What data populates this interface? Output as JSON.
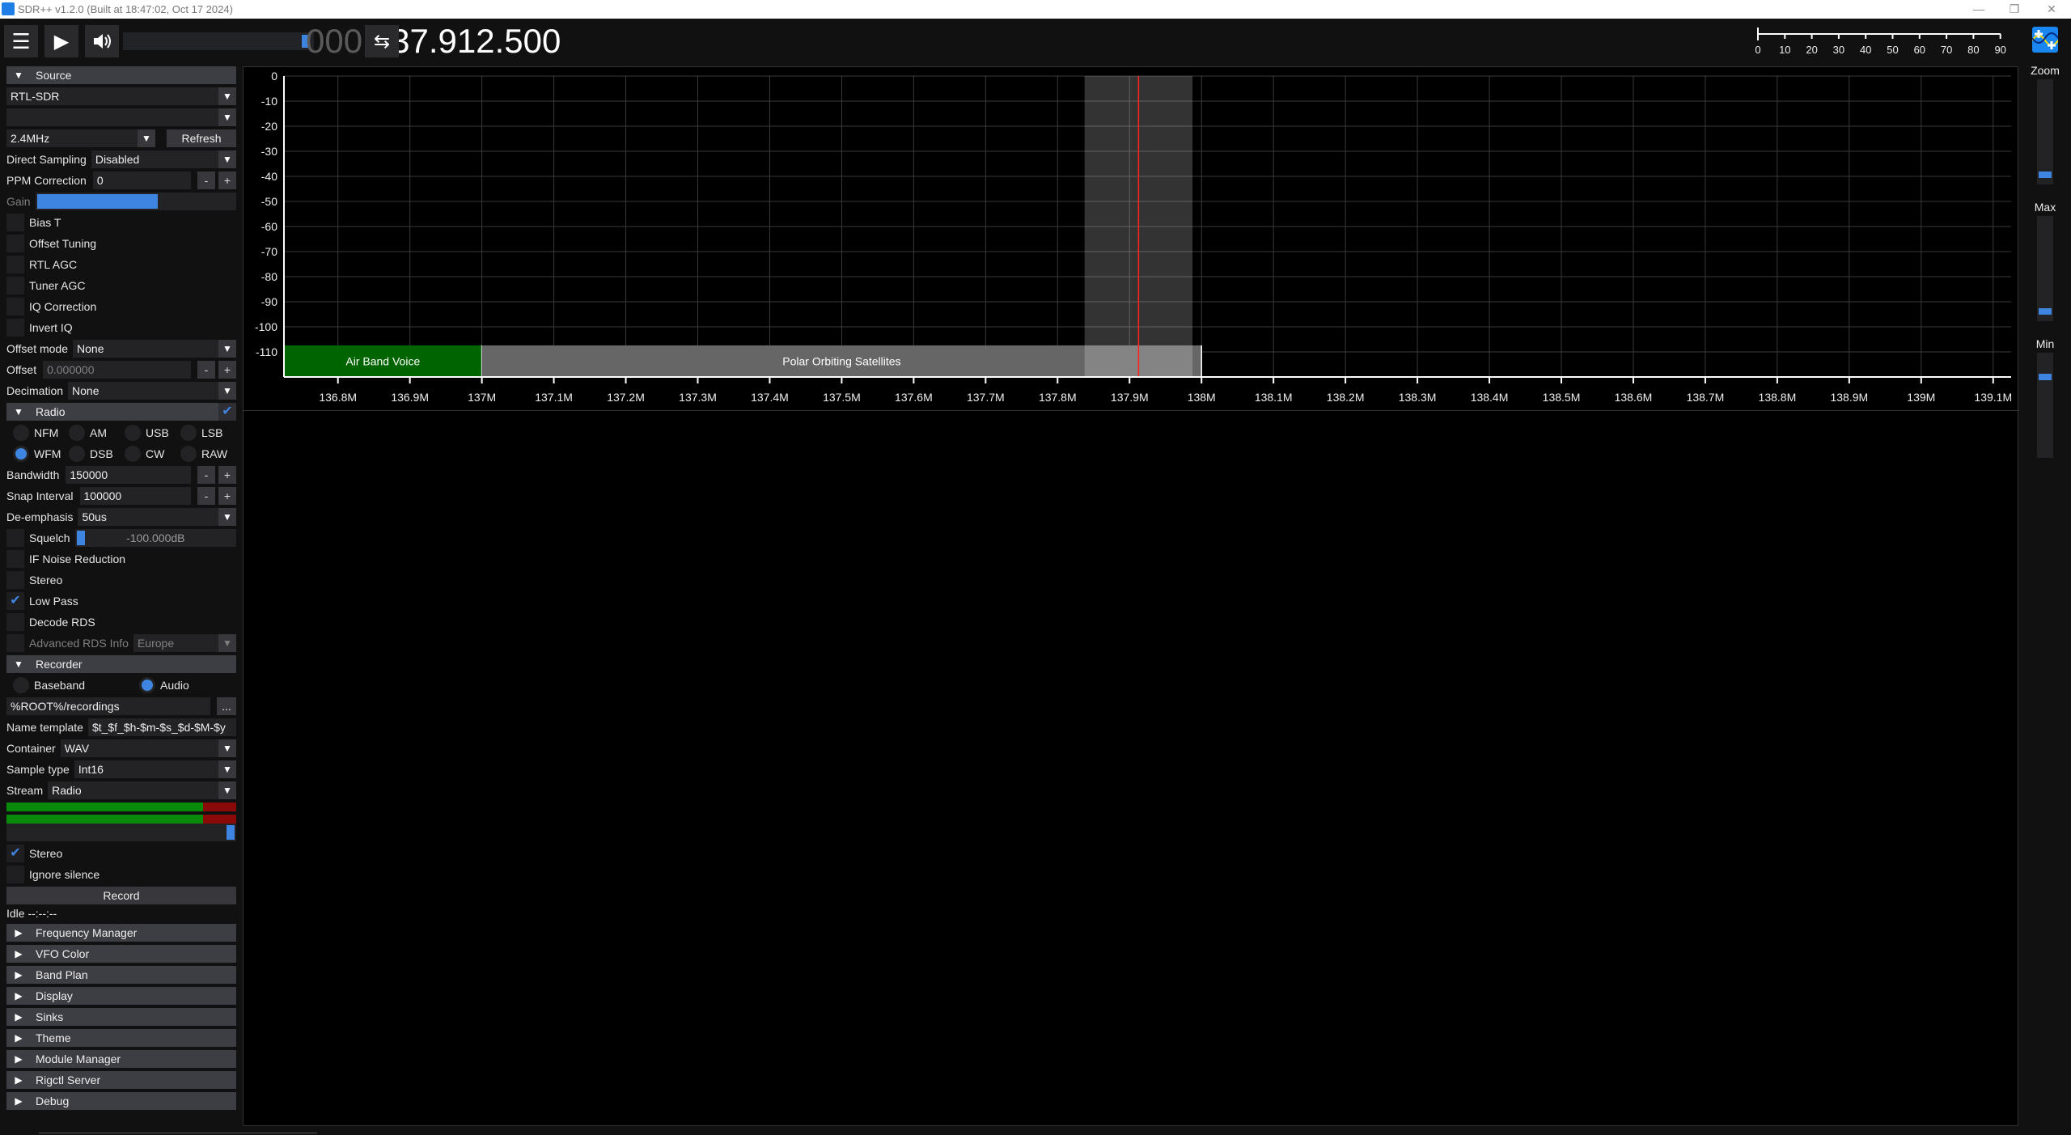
{
  "window": {
    "title": "SDR++ v1.2.0 (Built at 18:47:02, Oct 17 2024)",
    "controls": {
      "minimize": "—",
      "restore": "❐",
      "close": "✕"
    }
  },
  "toolbar": {
    "frequency_lead": "000.",
    "frequency": "137.912.500",
    "volume": 0.95,
    "swap_icon": "⇆",
    "menu_icon": "☰",
    "play_icon": "▶",
    "volume_icon": "🔊"
  },
  "snr_meter": {
    "ticks": [
      "0",
      "10",
      "20",
      "30",
      "40",
      "50",
      "60",
      "70",
      "80",
      "90"
    ]
  },
  "source": {
    "title": "Source",
    "device": "RTL-SDR",
    "device2": "",
    "samplerate": "2.4MHz",
    "refresh": "Refresh",
    "direct_sampling_label": "Direct Sampling",
    "direct_sampling": "Disabled",
    "ppm_label": "PPM Correction",
    "ppm": "0",
    "gain_label": "Gain",
    "gain": 0.6,
    "checkboxes": [
      {
        "label": "Bias T",
        "checked": false
      },
      {
        "label": "Offset Tuning",
        "checked": false
      },
      {
        "label": "RTL AGC",
        "checked": false
      },
      {
        "label": "Tuner AGC",
        "checked": false
      },
      {
        "label": "IQ Correction",
        "checked": false
      },
      {
        "label": "Invert IQ",
        "checked": false
      }
    ],
    "offset_mode_label": "Offset mode",
    "offset_mode": "None",
    "offset_label": "Offset",
    "offset": "0.000000",
    "decimation_label": "Decimation",
    "decimation": "None"
  },
  "radio": {
    "title": "Radio",
    "enabled": true,
    "modes": [
      "NFM",
      "AM",
      "USB",
      "LSB",
      "WFM",
      "DSB",
      "CW",
      "RAW"
    ],
    "selected": "WFM",
    "bandwidth_label": "Bandwidth",
    "bandwidth": "150000",
    "snap_label": "Snap Interval",
    "snap": "100000",
    "deemph_label": "De-emphasis",
    "deemph": "50us",
    "squelch_label": "Squelch",
    "squelch_value": "-100.000dB",
    "checks": [
      {
        "label": "IF Noise Reduction",
        "checked": false
      },
      {
        "label": "Stereo",
        "checked": false
      },
      {
        "label": "Low Pass",
        "checked": true
      },
      {
        "label": "Decode RDS",
        "checked": false
      }
    ],
    "adv_rds_label": "Advanced RDS Info",
    "adv_rds": "Europe"
  },
  "recorder": {
    "title": "Recorder",
    "baseband": "Baseband",
    "audio": "Audio",
    "mode": "Audio",
    "path": "%ROOT%/recordings",
    "browse": "...",
    "name_template_label": "Name template",
    "name_template": "$t_$f_$h-$m-$s_$d-$M-$y",
    "container_label": "Container",
    "container": "WAV",
    "sample_type_label": "Sample type",
    "sample_type": "Int16",
    "stream_label": "Stream",
    "stream": "Radio",
    "stereo": "Stereo",
    "ignore_silence": "Ignore silence",
    "record": "Record",
    "status": "Idle --:--:--"
  },
  "collapsed_sections": [
    "Frequency Manager",
    "VFO Color",
    "Band Plan",
    "Display",
    "Sinks",
    "Theme",
    "Module Manager",
    "Rigctl Server",
    "Debug"
  ],
  "right_panel": {
    "zoom": "Zoom",
    "max": "Max",
    "min": "Min",
    "zoom_level": 0.05,
    "max_level": 0.05,
    "min_level": 0.8
  },
  "spectrum": {
    "x_range_mhz": [
      136.725,
      139.125
    ],
    "y_range_db": [
      -120,
      0
    ],
    "y_ticks": [
      "0",
      "-10",
      "-20",
      "-30",
      "-40",
      "-50",
      "-60",
      "-70",
      "-80",
      "-90",
      "-100",
      "-110"
    ],
    "x_ticks": [
      "136.8M",
      "136.9M",
      "137M",
      "137.1M",
      "137.2M",
      "137.3M",
      "137.4M",
      "137.5M",
      "137.6M",
      "137.7M",
      "137.8M",
      "137.9M",
      "138M",
      "138.1M",
      "138.2M",
      "138.3M",
      "138.4M",
      "138.5M",
      "138.6M",
      "138.7M",
      "138.8M",
      "138.9M",
      "139M",
      "139.1M"
    ],
    "bands": [
      {
        "name": "Air Band Voice",
        "start": 136.725,
        "end": 137.0,
        "color": "#006400"
      },
      {
        "name": "Polar Orbiting Satellites",
        "start": 137.0,
        "end": 138.0,
        "color": "#666666"
      }
    ],
    "vfo": {
      "center": 137.9125,
      "bandwidth_mhz": 0.15,
      "color": "#ff2020"
    }
  },
  "colors": {
    "accent": "#3d85e0",
    "meter_green": "#0a8a0a",
    "meter_red": "#8a0a0a"
  }
}
